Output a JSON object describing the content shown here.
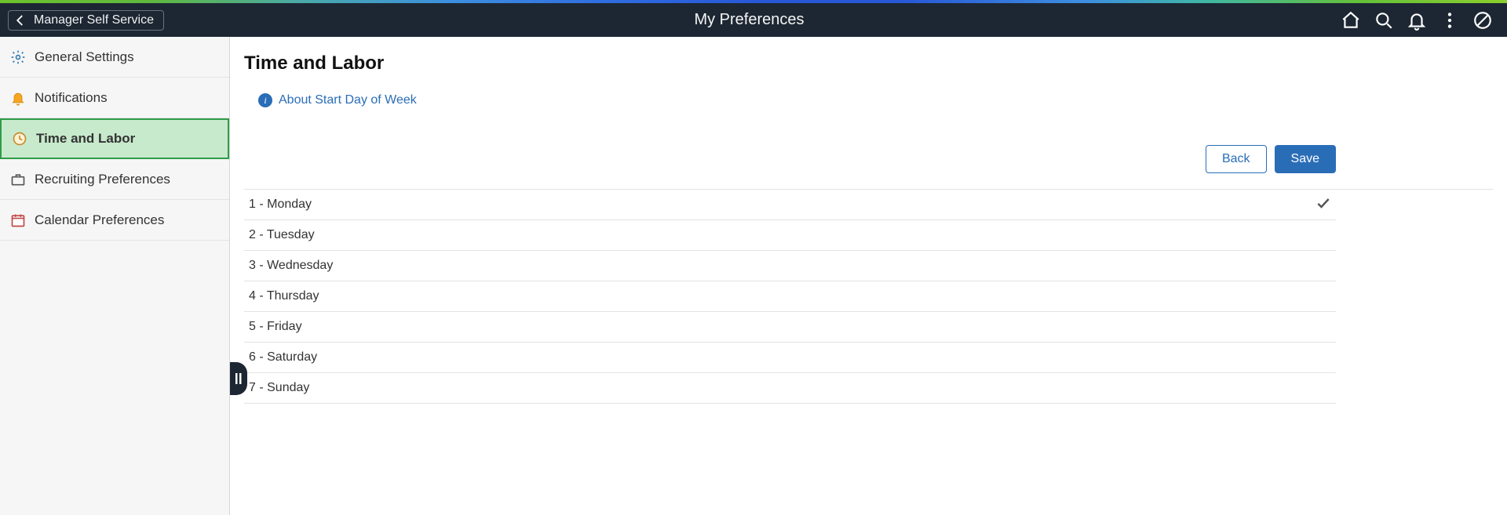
{
  "header": {
    "back_label": "Manager Self Service",
    "title": "My Preferences"
  },
  "sidebar": {
    "items": [
      {
        "label": "General Settings",
        "icon": "gear",
        "active": false
      },
      {
        "label": "Notifications",
        "icon": "bell",
        "active": false
      },
      {
        "label": "Time and Labor",
        "icon": "clock",
        "active": true
      },
      {
        "label": "Recruiting Preferences",
        "icon": "briefcase",
        "active": false
      },
      {
        "label": "Calendar Preferences",
        "icon": "calendar",
        "active": false
      }
    ]
  },
  "main": {
    "title": "Time and Labor",
    "info_link": "About Start Day of Week",
    "back_button": "Back",
    "save_button": "Save",
    "days": [
      {
        "label": "1 - Monday",
        "selected": true
      },
      {
        "label": "2 - Tuesday",
        "selected": false
      },
      {
        "label": "3 - Wednesday",
        "selected": false
      },
      {
        "label": "4 - Thursday",
        "selected": false
      },
      {
        "label": "5 - Friday",
        "selected": false
      },
      {
        "label": "6 - Saturday",
        "selected": false
      },
      {
        "label": "7 - Sunday",
        "selected": false
      }
    ]
  }
}
